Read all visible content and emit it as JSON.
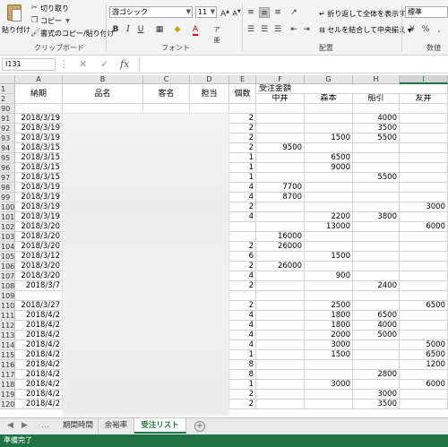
{
  "ribbon": {
    "clipboard": {
      "paste_label": "貼り付け",
      "cut_label": "切り取り",
      "copy_label": "コピー",
      "format_painter_label": "書式のコピー/貼り付け",
      "group_label": "クリップボード"
    },
    "font": {
      "font_name": "游ゴシック",
      "font_size": "11",
      "group_label": "フォント"
    },
    "alignment": {
      "wrap_text_label": "折り返して全体を表示する",
      "merge_center_label": "セルを結合して中央揃え",
      "group_label": "配置"
    },
    "number": {
      "format": "標準",
      "group_label": "数値",
      "percent_symbol": "%",
      "comma_symbol": ","
    }
  },
  "formula_bar": {
    "name_box": "I131",
    "cancel_symbol": "✕",
    "enter_symbol": "✓",
    "fx_label": "fx",
    "value": ""
  },
  "columns": [
    "A",
    "B",
    "C",
    "D",
    "E",
    "F",
    "G",
    "H",
    "I"
  ],
  "selected_column": "I",
  "header_rows": {
    "row_numbers": [
      "1",
      "2"
    ],
    "labels": {
      "date": "納期",
      "product": "品名",
      "customer": "客名",
      "staff": "担当",
      "qty": "個数",
      "order_amount": "受注金額",
      "nakai": "中井",
      "morimoto": "森本",
      "funabiki": "船引",
      "tomoi": "友井"
    }
  },
  "rows": [
    {
      "n": "90",
      "date": "",
      "qty": "",
      "f": "",
      "g": "",
      "h": "",
      "i": ""
    },
    {
      "n": "91",
      "date": "2018/3/19",
      "qty": "2",
      "f": "",
      "g": "",
      "h": "4000",
      "i": ""
    },
    {
      "n": "92",
      "date": "2018/3/19",
      "qty": "2",
      "f": "",
      "g": "",
      "h": "3500",
      "i": ""
    },
    {
      "n": "93",
      "date": "2018/3/19",
      "qty": "2",
      "f": "",
      "g": "1500",
      "h": "5500",
      "i": ""
    },
    {
      "n": "94",
      "date": "2018/3/15",
      "qty": "2",
      "f": "9500",
      "g": "",
      "h": "",
      "i": ""
    },
    {
      "n": "95",
      "date": "2018/3/15",
      "qty": "1",
      "f": "",
      "g": "6500",
      "h": "",
      "i": ""
    },
    {
      "n": "96",
      "date": "2018/3/15",
      "qty": "1",
      "f": "",
      "g": "9000",
      "h": "",
      "i": ""
    },
    {
      "n": "97",
      "date": "2018/3/15",
      "qty": "1",
      "f": "",
      "g": "",
      "h": "5500",
      "i": ""
    },
    {
      "n": "98",
      "date": "2018/3/19",
      "qty": "4",
      "f": "7700",
      "g": "",
      "h": "",
      "i": ""
    },
    {
      "n": "99",
      "date": "2018/3/19",
      "qty": "4",
      "f": "8700",
      "g": "",
      "h": "",
      "i": ""
    },
    {
      "n": "100",
      "date": "2018/3/19",
      "qty": "2",
      "f": "",
      "g": "",
      "h": "",
      "i": "3000"
    },
    {
      "n": "101",
      "date": "2018/3/19",
      "qty": "4",
      "f": "",
      "g": "2200",
      "h": "3800",
      "i": ""
    },
    {
      "n": "102",
      "date": "2018/3/20",
      "qty": "",
      "f": "",
      "g": "13000",
      "h": "",
      "i": "6000"
    },
    {
      "n": "103",
      "date": "2018/3/20",
      "qty": "",
      "f": "16000",
      "g": "",
      "h": "",
      "i": ""
    },
    {
      "n": "104",
      "date": "2018/3/20",
      "qty": "2",
      "f": "26000",
      "g": "",
      "h": "",
      "i": ""
    },
    {
      "n": "105",
      "date": "2018/3/12",
      "qty": "6",
      "f": "",
      "g": "1500",
      "h": "",
      "i": ""
    },
    {
      "n": "106",
      "date": "2018/3/20",
      "qty": "2",
      "f": "26000",
      "g": "",
      "h": "",
      "i": ""
    },
    {
      "n": "107",
      "date": "2018/3/20",
      "qty": "4",
      "f": "",
      "g": "900",
      "h": "",
      "i": ""
    },
    {
      "n": "108",
      "date": "2018/3/7",
      "qty": "2",
      "f": "",
      "g": "",
      "h": "2400",
      "i": ""
    },
    {
      "n": "109",
      "date": "",
      "qty": "",
      "f": "",
      "g": "",
      "h": "",
      "i": ""
    },
    {
      "n": "110",
      "date": "2018/3/27",
      "qty": "2",
      "f": "",
      "g": "2500",
      "h": "",
      "i": "6500"
    },
    {
      "n": "111",
      "date": "2018/4/2",
      "qty": "4",
      "f": "",
      "g": "1800",
      "h": "6500",
      "i": ""
    },
    {
      "n": "112",
      "date": "2018/4/2",
      "qty": "4",
      "f": "",
      "g": "1800",
      "h": "4000",
      "i": ""
    },
    {
      "n": "113",
      "date": "2018/4/2",
      "qty": "4",
      "f": "",
      "g": "2000",
      "h": "5000",
      "i": ""
    },
    {
      "n": "114",
      "date": "2018/4/2",
      "qty": "4",
      "f": "",
      "g": "3000",
      "h": "",
      "i": "5000"
    },
    {
      "n": "115",
      "date": "2018/4/2",
      "qty": "1",
      "f": "",
      "g": "1500",
      "h": "",
      "i": "6500"
    },
    {
      "n": "116",
      "date": "2018/4/2",
      "qty": "8",
      "f": "",
      "g": "",
      "h": "",
      "i": "1200"
    },
    {
      "n": "117",
      "date": "2018/4/2",
      "qty": "8",
      "f": "",
      "g": "",
      "h": "2800",
      "i": ""
    },
    {
      "n": "118",
      "date": "2018/4/2",
      "qty": "1",
      "f": "",
      "g": "3000",
      "h": "",
      "i": "6000"
    },
    {
      "n": "119",
      "date": "2018/4/2",
      "qty": "2",
      "f": "",
      "g": "",
      "h": "3000",
      "i": ""
    },
    {
      "n": "120",
      "date": "2018/4/2",
      "qty": "2",
      "f": "",
      "g": "",
      "h": "3500",
      "i": ""
    }
  ],
  "sheet_tabs": [
    "期間時間",
    "余裕率",
    "受注リスト"
  ],
  "active_tab": "受注リスト",
  "add_sheet_symbol": "+",
  "status": "準備完了"
}
